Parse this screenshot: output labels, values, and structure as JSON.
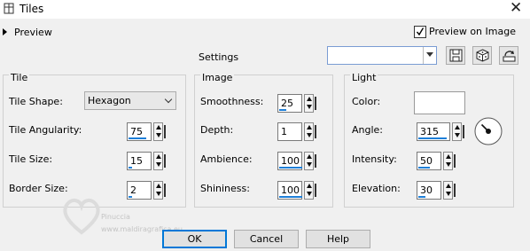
{
  "window": {
    "title": "Tiles"
  },
  "preview": {
    "label": "Preview"
  },
  "preview_on_image": {
    "label": "Preview on Image",
    "checked": true
  },
  "settings": {
    "label": "Settings",
    "preset_value": ""
  },
  "tile": {
    "title": "Tile",
    "shape_label": "Tile Shape:",
    "shape_value": "Hexagon",
    "angularity_label": "Tile Angularity:",
    "angularity": "75",
    "size_label": "Tile Size:",
    "size": "15",
    "border_label": "Border Size:",
    "border": "2"
  },
  "image": {
    "title": "Image",
    "smoothness_label": "Smoothness:",
    "smoothness": "25",
    "depth_label": "Depth:",
    "depth": "1",
    "ambience_label": "Ambience:",
    "ambience": "100",
    "shininess_label": "Shininess:",
    "shininess": "100"
  },
  "light": {
    "title": "Light",
    "color_label": "Color:",
    "color": "#ffffff",
    "angle_label": "Angle:",
    "angle": "315",
    "intensity_label": "Intensity:",
    "intensity": "50",
    "elevation_label": "Elevation:",
    "elevation": "30"
  },
  "buttons": {
    "ok": "OK",
    "cancel": "Cancel",
    "help": "Help"
  },
  "watermark": {
    "line1": "Pinuccia",
    "line2": "www.maldiragrafica.eu"
  },
  "icons": [
    "tiles-app-icon",
    "close-icon",
    "expand-arrow-icon",
    "checkmark-icon",
    "chevron-down-icon",
    "save-preset-icon",
    "randomize-icon",
    "reset-icon",
    "light-direction-dial-icon"
  ],
  "accent": "#1e7fd8"
}
